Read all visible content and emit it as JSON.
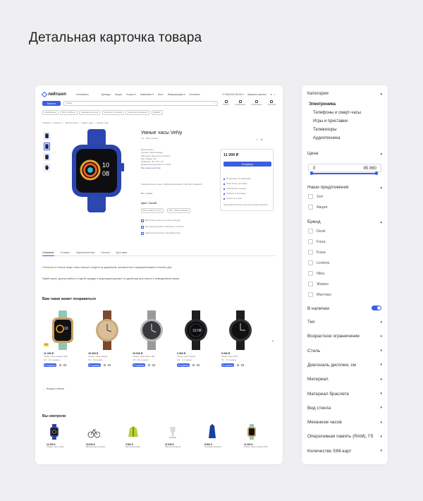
{
  "page": {
    "title": "Детальная карточка товара"
  },
  "header": {
    "logo": "лейтшоп",
    "city": "Челябинск",
    "nav": [
      "Бренды",
      "Акции",
      "Услуги ▾",
      "Компания ▾",
      "Блог",
      "Информация ▾",
      "Контакты"
    ],
    "phone": "+7 906 000-00-00 ▾",
    "callback": "Заказать звонок",
    "catalog_btn": "Каталог",
    "search_placeholder": "Поиск",
    "icons": [
      {
        "label": "Войти",
        "icon": "user-icon"
      },
      {
        "label": "Сравнение",
        "icon": "compare-icon"
      },
      {
        "label": "Избранное",
        "icon": "heart-icon"
      },
      {
        "label": "Корзина",
        "icon": "cart-icon"
      }
    ],
    "chips": [
      "Смартфоны",
      "Всё о работе",
      "Одежда на осень",
      "Комплект питания",
      "Набор для рыбалки",
      "Домкат"
    ]
  },
  "breadcrumbs": [
    "Главная",
    "•",
    "Каталог",
    "•",
    "Электроника",
    "•",
    "Смарт-часы",
    "•",
    "Умные часы"
  ],
  "product": {
    "title": "Умные часы VeNy",
    "rating": "5.0 · 156 отзывов",
    "specs": [
      "Бренд Velion",
      "Страна: Смартландия",
      "Материал браслета: Силикон",
      "Вес товара: 30 г",
      "Габариты: 40 × 35 × 10",
      "Водонепроницаемость: 5 ATM",
      "Все характеристики"
    ],
    "specs_more": "Универсальные часы с набором функций и быстрой зарядкой",
    "all_specs": "Все отзывы",
    "color_label": "Цвет: Синий",
    "colors": [
      "Все товары услуги",
      "Все товары бренда"
    ],
    "features": [
      "Доступные цены на лучшие бренды",
      "Быстрая доставка по Москве и области",
      "Гарантия качества и производителя"
    ],
    "price": "11 000 ₽",
    "cart_btn": "В корзину",
    "buy_lines": [
      "В наличии в 5 магазинах",
      "Рассчитать доставку",
      "Самовывоз сегодня",
      "Забрать в магазине",
      "Купить в 1 клик"
    ],
    "buy_note": "Цена действительна только для интернет-магазина"
  },
  "tabs": [
    "Описание",
    "Отзывы",
    "Характеристики",
    "Оплата",
    "Доставка"
  ],
  "description": [
    "Стильные и точные смарт-часы помогут следить за здоровьем, активностью и уведомлениями в течение дня.",
    "Яркий экран, долгая работа от одной зарядки и водозащита делают их удобными для спорта и повседневной жизни."
  ],
  "recommended": {
    "title": "Вам также может понравиться",
    "items": [
      {
        "price": "11 000 ₽",
        "name": "Смарт-часы Garden 003",
        "meta": "5.0 · 12 отзывов",
        "btn": "В корзину",
        "badge": "Хит",
        "kind": "square-green"
      },
      {
        "price": "15 000 ₽",
        "name": "Умные часы Classic",
        "meta": "5.0 · 9 отзывов",
        "btn": "В корзину",
        "kind": "round-gold"
      },
      {
        "price": "15 000 ₽",
        "name": "Умные часы Silver 108",
        "meta": "4.9 · 18 отзывов",
        "btn": "В корзину",
        "kind": "round-silver"
      },
      {
        "price": "3 000 ₽",
        "name": "Смарт-часы Nordix",
        "meta": "4.8 · 7 отзывов",
        "btn": "В корзину",
        "kind": "round-black"
      },
      {
        "price": "8 000 ₽",
        "name": "Смарт-часы BX 3",
        "meta": "5.0 · 5 отзывов",
        "btn": "В корзину",
        "kind": "round-black2"
      }
    ]
  },
  "back_link": "Назад в список",
  "viewed": {
    "title": "Вы смотрели",
    "items": [
      {
        "price": "11 000 ₽",
        "name": "Умные часы VeNy",
        "kind": "watch"
      },
      {
        "price": "15 000 ₽",
        "name": "Велосипед детский",
        "kind": "bike"
      },
      {
        "price": "3 000 ₽",
        "name": "Куртка детская",
        "kind": "jacket"
      },
      {
        "price": "21 000 ₽",
        "name": "Кресло-качалка",
        "kind": "chair"
      },
      {
        "price": "8 000 ₽",
        "name": "Пуховик женский",
        "kind": "coat"
      },
      {
        "price": "11 000 ₽",
        "name": "Смарт-часы Garden 003",
        "kind": "watch-green"
      }
    ]
  },
  "filters": {
    "category": {
      "title": "Категория",
      "selected": "Электроника",
      "options": [
        "Телефоны и смарт-часы",
        "Игры и приставки",
        "Телевизоры",
        "Аудиотехника"
      ]
    },
    "price": {
      "title": "Цена",
      "from": "0",
      "to": "85 860",
      "low": 0,
      "high": 1
    },
    "offers": {
      "title": "Наши предложения",
      "options": [
        "Хит",
        "Акция"
      ]
    },
    "brand": {
      "title": "Бренд",
      "options": [
        "Desli",
        "Fasa",
        "Kasa",
        "Lindros",
        "Nika",
        "Жерко",
        "Маттикс"
      ]
    },
    "in_stock": {
      "label": "В наличии",
      "on": true
    },
    "groups": [
      "Тип",
      "Возрастное ограничение",
      "Стиль",
      "Диагональ дисплея, см",
      "Материал",
      "Материал браслета",
      "Вид стекла",
      "Механизм часов",
      "Оперативная память (RAM), Гб",
      "Количество SIM-карт"
    ]
  },
  "colors": {
    "accent": "#3d5ee0",
    "watch_blue": "#2b44a8",
    "badge": "#f7d547"
  }
}
